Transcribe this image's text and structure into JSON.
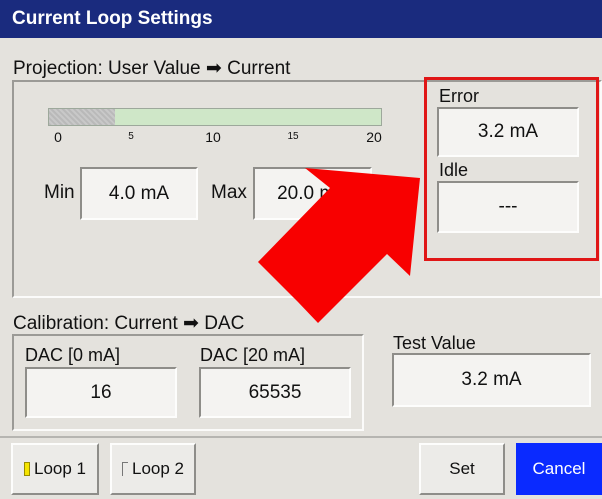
{
  "window": {
    "title": "Current Loop Settings"
  },
  "projection": {
    "label": "Projection: User Value ➡ Current",
    "scale": {
      "fill_fraction": 0.2,
      "ticks": [
        "0",
        "5",
        "10",
        "15",
        "20"
      ]
    },
    "min_label": "Min",
    "min_value": "4.0 mA",
    "max_label": "Max",
    "max_value": "20.0 mA"
  },
  "fault": {
    "error_label": "Error",
    "error_value": "3.2 mA",
    "idle_label": "Idle",
    "idle_value": "---"
  },
  "calibration": {
    "label": "Calibration: Current ➡ DAC",
    "dac0_label": "DAC [0 mA]",
    "dac0_value": "16",
    "dac20_label": "DAC [20 mA]",
    "dac20_value": "65535"
  },
  "test": {
    "label": "Test Value",
    "value": "3.2 mA"
  },
  "footer": {
    "loop1_label": "Loop 1",
    "loop2_label": "Loop 2",
    "set_label": "Set",
    "cancel_label": "Cancel"
  },
  "colors": {
    "title_bar": "#1a2b7e",
    "accent": "#0a2aff",
    "highlight": "#e01616",
    "indicator_on": "#f5e400"
  }
}
